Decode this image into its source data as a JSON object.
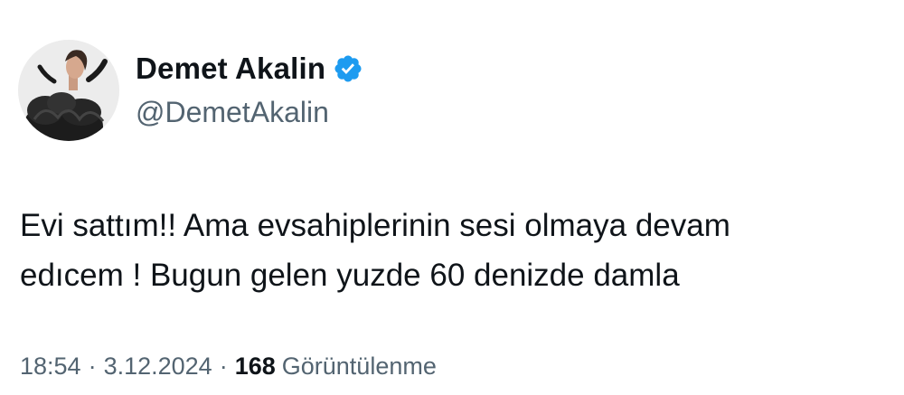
{
  "author": {
    "display_name": "Demet Akalin",
    "handle": "@DemetAkalin",
    "verified_icon": "verified-badge-icon",
    "verified_color": "#1d9bf0"
  },
  "tweet": {
    "text_lines": [
      "Evi sattım!! Ama evsahiplerinin sesi olmaya devam",
      "edıcem ! Bugun gelen yuzde 60 denizde damla"
    ],
    "time": "18:54",
    "separator": "·",
    "date": "3.12.2024",
    "views_count": "168",
    "views_label": "Görüntülenme"
  },
  "colors": {
    "text_primary": "#0f1419",
    "text_secondary": "#536471"
  }
}
